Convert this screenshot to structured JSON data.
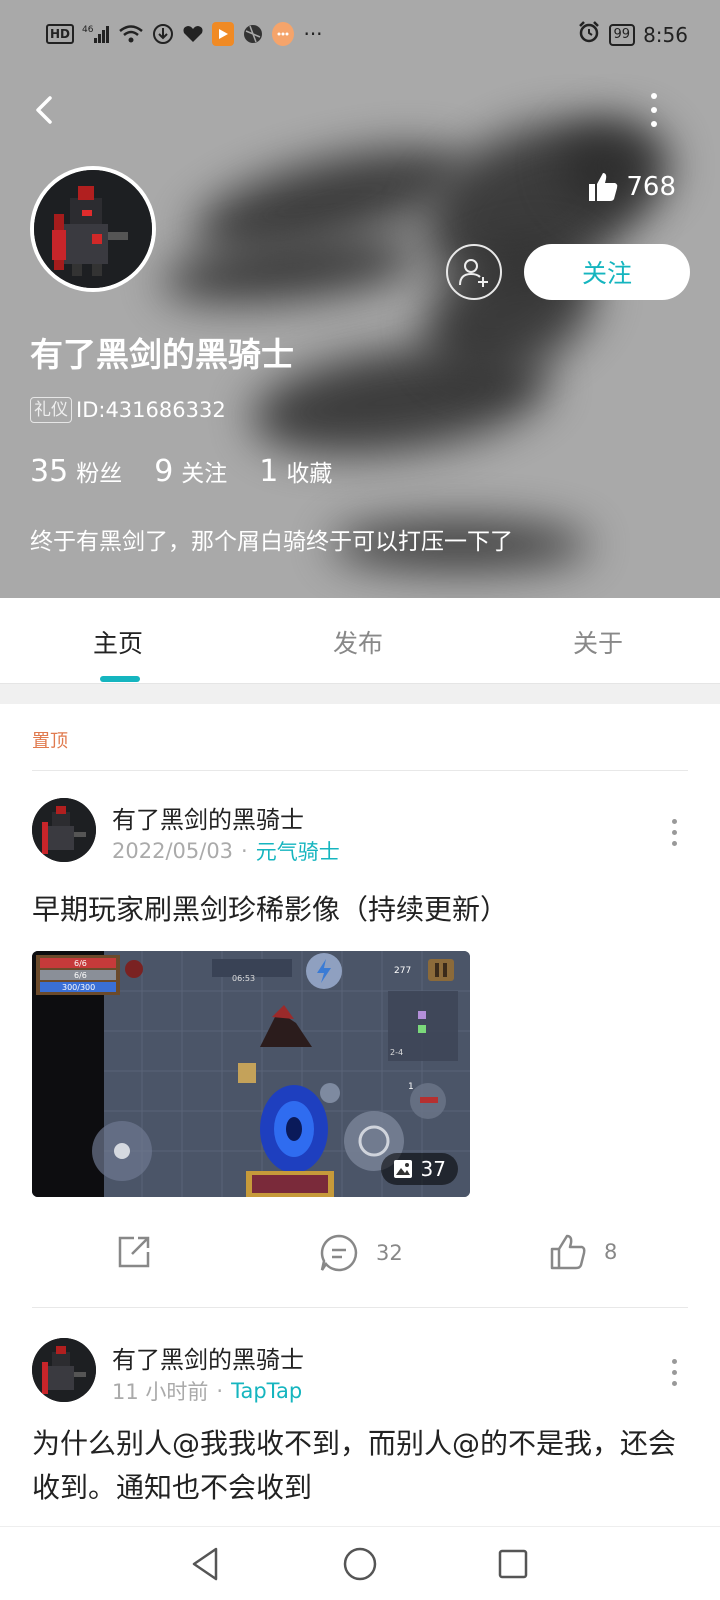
{
  "status_bar": {
    "network_label": "HD",
    "signal_label": "46",
    "battery": "99",
    "time": "8:56"
  },
  "profile": {
    "likes": "768",
    "follow_label": "关注",
    "username": "有了黑剑的黑骑士",
    "badge": "礼仪",
    "user_id": "ID:431686332",
    "stats": [
      {
        "value": "35",
        "label": "粉丝"
      },
      {
        "value": "9",
        "label": "关注"
      },
      {
        "value": "1",
        "label": "收藏"
      }
    ],
    "bio": "终于有黑剑了，那个屑白骑终于可以打压一下了"
  },
  "tabs": [
    {
      "label": "主页",
      "active": true
    },
    {
      "label": "发布",
      "active": false
    },
    {
      "label": "关于",
      "active": false
    }
  ],
  "feed": {
    "pinned_label": "置顶",
    "posts": [
      {
        "author": "有了黑剑的黑骑士",
        "date": "2022/05/03",
        "source": "元气骑士",
        "title": "早期玩家刷黑剑珍稀影像（持续更新）",
        "image_count": "37",
        "comments": "32",
        "likes": "8",
        "game_hud": {
          "hp": "6/6",
          "armor": "6/6",
          "energy": "300/300",
          "timer": "06:53",
          "coins": "277",
          "level": "2-4",
          "skill_level": "1"
        }
      },
      {
        "author": "有了黑剑的黑骑士",
        "date": "11 小时前",
        "source": "TapTap",
        "text": "为什么别人@我我收不到，而别人@的不是我，还会收到。通知也不会收到"
      }
    ]
  },
  "colors": {
    "accent": "#15b5bf",
    "pinned": "#e07a4e",
    "header_bg": "#a9a9a9"
  }
}
